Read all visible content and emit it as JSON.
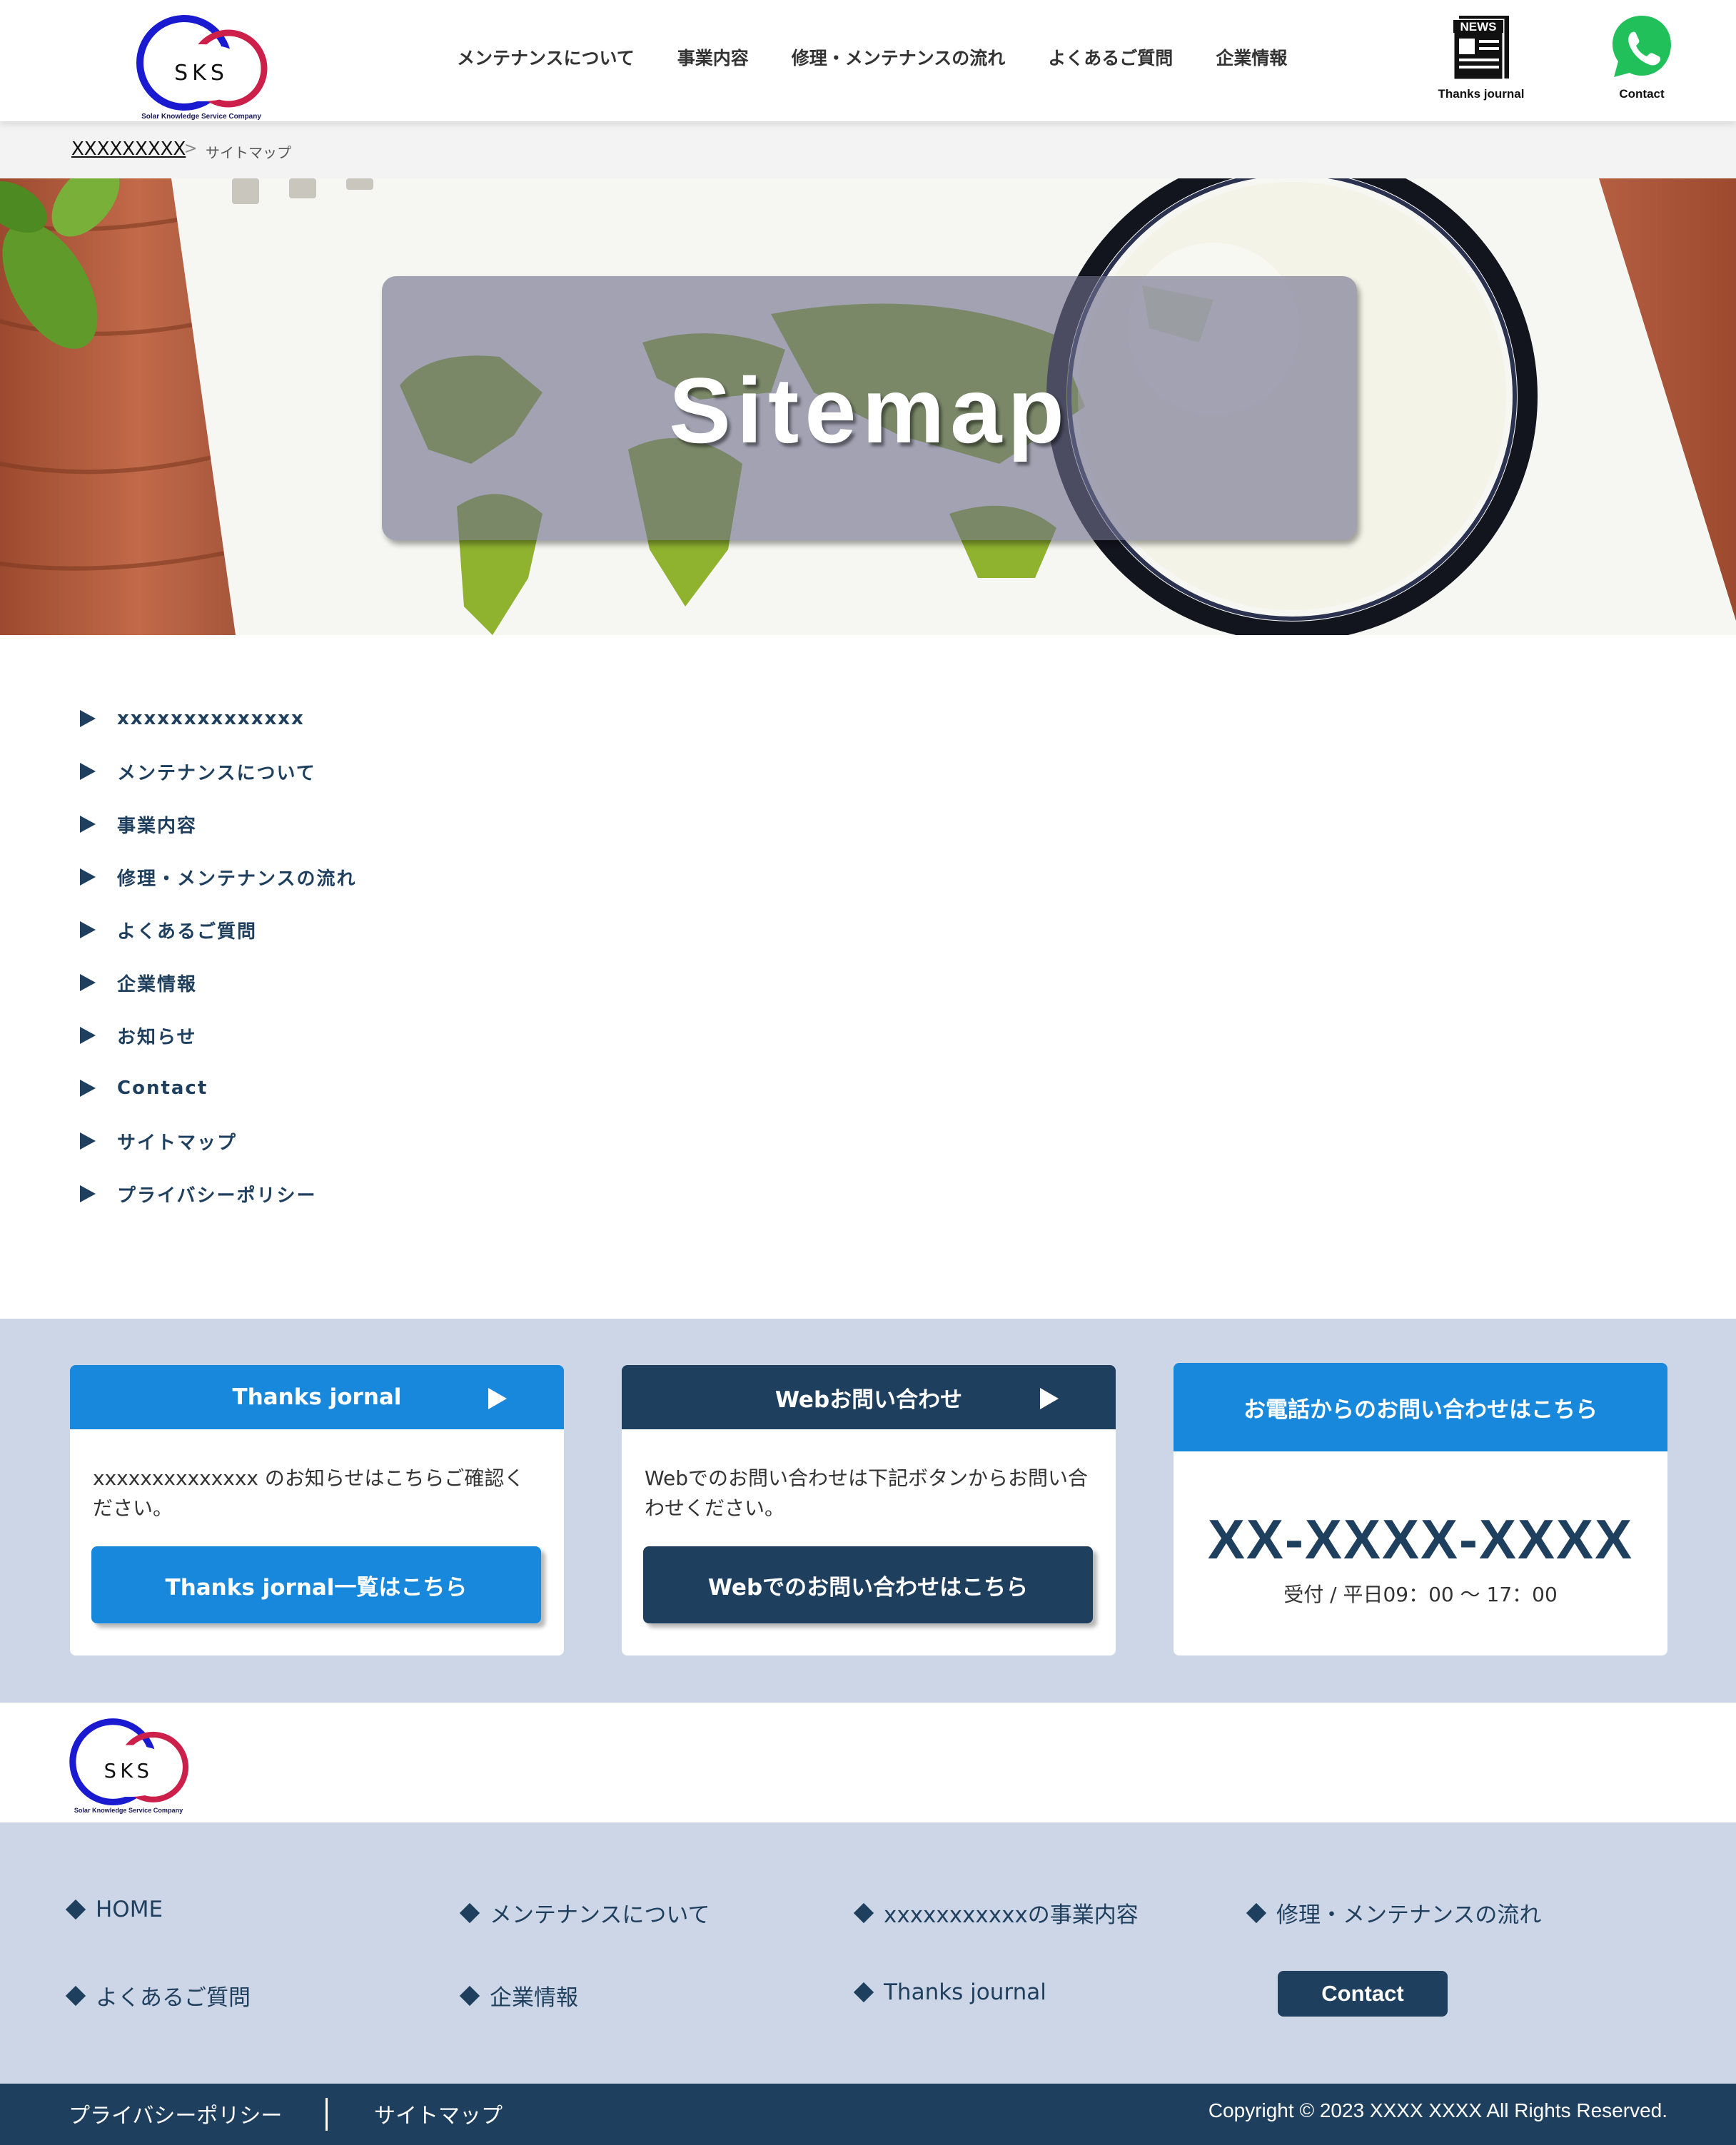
{
  "header": {
    "logo_initials": "SKS",
    "logo_tagline": "Solar Knowledge Service Company",
    "nav": [
      "メンテナンスについて",
      "事業内容",
      "修理・メンテナンスの流れ",
      "よくあるご質問",
      "企業情報"
    ],
    "news_badge": "NEWS",
    "news_label": "Thanks journal",
    "contact_label": "Contact"
  },
  "breadcrumb": {
    "home": "XXXXXXXXX",
    "separator": ">",
    "current": "サイトマップ"
  },
  "hero": {
    "title": "Sitemap"
  },
  "sitemap": {
    "items": [
      "xxxxxxxxxxxxxx",
      "メンテナンスについて",
      "事業内容",
      "修理・メンテナンスの流れ",
      "よくあるご質問",
      "企業情報",
      "お知らせ",
      "Contact",
      "サイトマップ",
      "プライバシーポリシー"
    ]
  },
  "cta": {
    "thanks": {
      "title": "Thanks jornal",
      "text": "xxxxxxxxxxxxxx のお知らせはこちらご確認ください。",
      "button": "Thanks jornal一覧はこちら"
    },
    "web": {
      "title": "Webお問い合わせ",
      "text": "Webでのお問い合わせは下記ボタンからお問い合わせください。",
      "button": "Webでのお問い合わせはこちら"
    },
    "phone": {
      "title": "お電話からのお問い合わせはこちら",
      "number": "XX-XXXX-XXXX",
      "hours": "受付 / 平日09：00 ～ 17：00"
    }
  },
  "footer": {
    "logo_initials": "SKS",
    "logo_tagline": "Solar Knowledge Service Company",
    "nav": [
      "HOME",
      "メンテナンスについて",
      "xxxxxxxxxxxの事業内容",
      "修理・メンテナンスの流れ",
      "よくあるご質問",
      "企業情報",
      "Thanks journal"
    ],
    "contact_button": "Contact",
    "bottom_links": [
      "プライバシーポリシー",
      "サイトマップ"
    ],
    "copyright": "Copyright © 2023 XXXX XXXX All Rights Reserved."
  },
  "colors": {
    "navy": "#1f3f5f",
    "blue": "#1888dd",
    "light_bg": "#cdd6e6",
    "map_green": "#8fb22f"
  }
}
